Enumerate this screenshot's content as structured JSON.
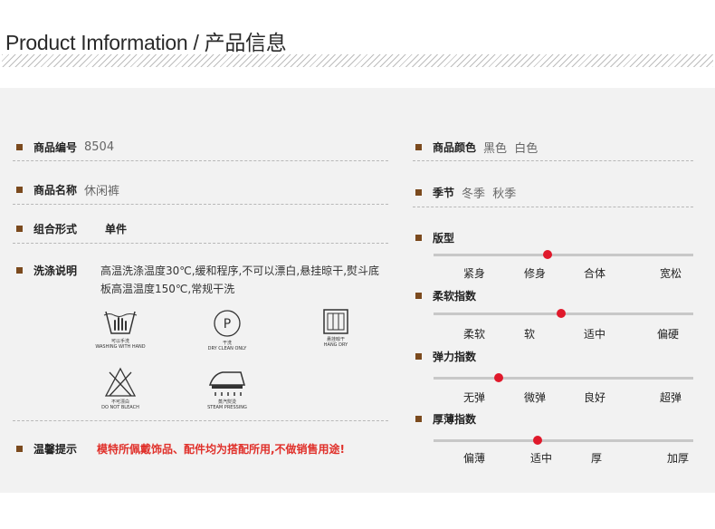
{
  "title": "Product Imformation / 产品信息",
  "left": {
    "code": {
      "label": "商品编号",
      "value": "8504"
    },
    "name": {
      "label": "商品名称",
      "value": "休闲裤"
    },
    "combo": {
      "label": "组合形式",
      "value": "单件"
    },
    "wash": {
      "label": "洗涤说明",
      "text": "高温洗涤温度30℃,缓和程序,不可以漂白,悬挂晾干,熨斗底板高温温度150℃,常规干洗"
    },
    "notice": {
      "label": "温馨提示",
      "text": "模特所佩戴饰品、配件均为搭配所用,不做销售用途!"
    }
  },
  "care_icons": [
    {
      "name": "hand-wash-icon",
      "zh": "可以手洗",
      "en": "WASHING WITH HAND"
    },
    {
      "name": "dry-clean-icon",
      "zh": "干洗",
      "en": "DRY CLEAN ONLY",
      "glyph": "P"
    },
    {
      "name": "hang-dry-icon",
      "zh": "悬挂晾干",
      "en": "HANG DRY"
    },
    {
      "name": "no-bleach-icon",
      "zh": "不可漂白",
      "en": "DO NOT BLEACH"
    },
    {
      "name": "steam-iron-icon",
      "zh": "蒸汽熨烫",
      "en": "STEAM PRESSING"
    }
  ],
  "right": {
    "color": {
      "label": "商品颜色",
      "value": "黑色  白色"
    },
    "season": {
      "label": "季节",
      "value": "冬季  秋季"
    }
  },
  "sliders": [
    {
      "label": "版型",
      "options": [
        "紧身",
        "修身",
        "合体",
        "宽松"
      ],
      "level": 0.44
    },
    {
      "label": "柔软指数",
      "options": [
        "柔软",
        "软",
        "适中",
        "偏硬"
      ],
      "level": 0.49
    },
    {
      "label": "弹力指数",
      "options": [
        "无弹",
        "微弹",
        "良好",
        "超弹"
      ],
      "level": 0.25
    },
    {
      "label": "厚薄指数",
      "options": [
        "偏薄",
        "适中",
        "厚",
        "加厚"
      ],
      "level": 0.4
    }
  ],
  "colors": {
    "accent": "#e0192b",
    "bullet": "#7b4a1e",
    "notice": "#e0302a"
  }
}
